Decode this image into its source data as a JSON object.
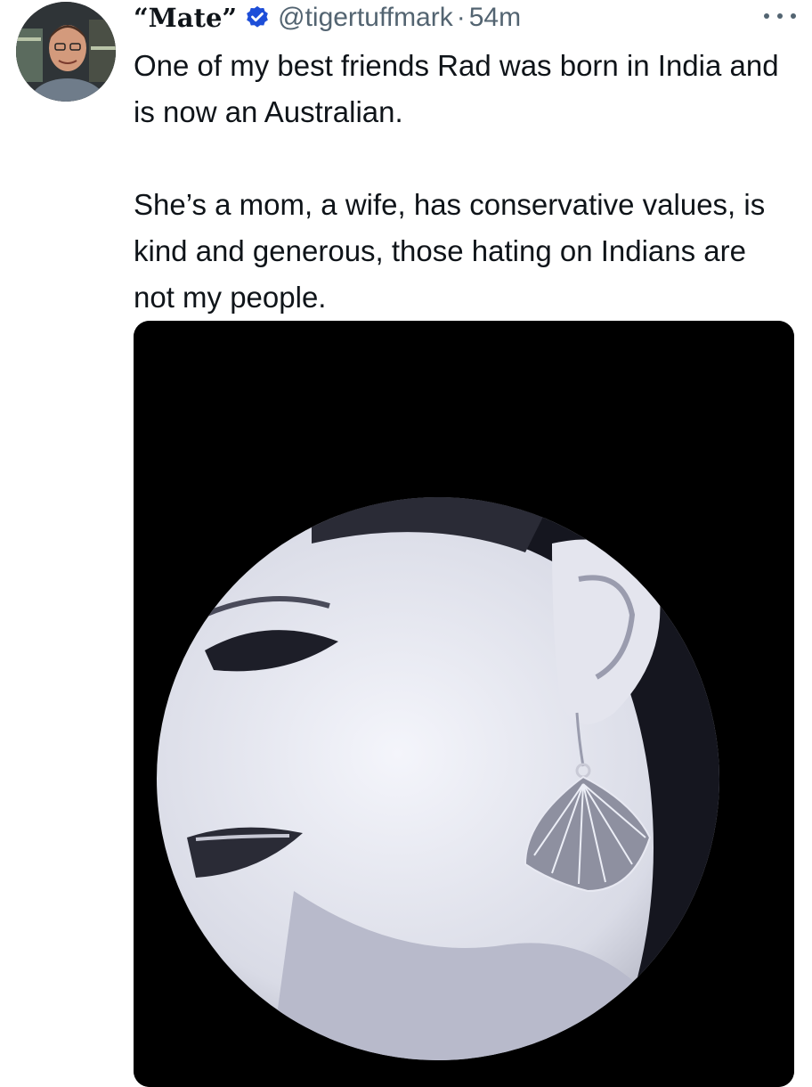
{
  "tweet": {
    "display_name": "“Mate”",
    "handle": "@tigertuffmark",
    "separator": "·",
    "time": "54m",
    "paragraphs": [
      "One of my best friends Rad was born in India and is now an Australian.",
      "She’s a mom, a wife, has conservative values, is kind and generous, those hating on Indians are not my people."
    ],
    "icons": {
      "verified": "verified-badge-icon",
      "more": "more-options-icon"
    },
    "colors": {
      "verified_badge": "#1d4ed8",
      "secondary_text": "#536471",
      "primary_text": "#0f1419",
      "media_background": "#000000"
    }
  }
}
